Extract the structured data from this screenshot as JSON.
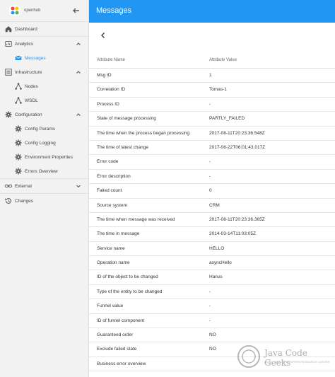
{
  "app": {
    "name": "openhub"
  },
  "header": {
    "title": "Messages"
  },
  "sidebar": {
    "items": [
      {
        "label": "Dashboard",
        "icon": "home-icon",
        "level": "top"
      },
      {
        "label": "Analytics",
        "icon": "analytics-icon",
        "level": "top",
        "expanded": true
      },
      {
        "label": "Messages",
        "icon": "email-icon",
        "level": "sub",
        "active": true
      },
      {
        "label": "Infrastructure",
        "icon": "infrastructure-icon",
        "level": "top",
        "expanded": true
      },
      {
        "label": "Nodes",
        "icon": "nodes-icon",
        "level": "sub"
      },
      {
        "label": "WSDL",
        "icon": "wsdl-icon",
        "level": "sub"
      },
      {
        "label": "Configuration",
        "icon": "gear-icon",
        "level": "top",
        "expanded": true
      },
      {
        "label": "Config Params",
        "icon": "gear-icon",
        "level": "sub"
      },
      {
        "label": "Config Logging",
        "icon": "gear-icon",
        "level": "sub"
      },
      {
        "label": "Environment Properties",
        "icon": "gear-icon",
        "level": "sub"
      },
      {
        "label": "Errors Overview",
        "icon": "gear-icon",
        "level": "sub"
      },
      {
        "label": "External",
        "icon": "link-icon",
        "level": "top",
        "expanded": false
      },
      {
        "label": "Changes",
        "icon": "history-icon",
        "level": "top"
      }
    ]
  },
  "table": {
    "columns": [
      "Attribute Name",
      "Attribute Value"
    ],
    "rows": [
      [
        "Msg ID",
        "1"
      ],
      [
        "Correlation ID",
        "Tomas-1"
      ],
      [
        "Process ID",
        "-"
      ],
      [
        "State of message processing",
        "PARTLY_FAILED"
      ],
      [
        "The time when the process began processing",
        "2017-08-11T20:23:36.548Z"
      ],
      [
        "The time of latest change",
        "2017-08-22T06:01:43.017Z"
      ],
      [
        "Error code",
        "-"
      ],
      [
        "Error description",
        "-"
      ],
      [
        "Failed count",
        "0"
      ],
      [
        "Source system",
        "CRM"
      ],
      [
        "The time when message was received",
        "2017-08-11T20:23:36.365Z"
      ],
      [
        "The time in message",
        "2014-03-14T11:03:05Z"
      ],
      [
        "Service name",
        "HELLO"
      ],
      [
        "Operation name",
        "asyncHello"
      ],
      [
        "ID of the object to be changed",
        "Hanus"
      ],
      [
        "Type of the entity to be changed",
        "-"
      ],
      [
        "Funnel value",
        "-"
      ],
      [
        "ID of funnel component",
        "-"
      ],
      [
        "Guaranteed order",
        "NO"
      ],
      [
        "Exclude failed state",
        "NO"
      ],
      [
        "Business error overview",
        ""
      ]
    ]
  },
  "watermark": {
    "title": "Java Code Geeks",
    "tagline": "JAVA 2 JAVA DEVELOPERS RESOURCE CENTER"
  },
  "colors": {
    "primary": "#2196f3",
    "sidebar_bg": "#f2f2f2"
  }
}
